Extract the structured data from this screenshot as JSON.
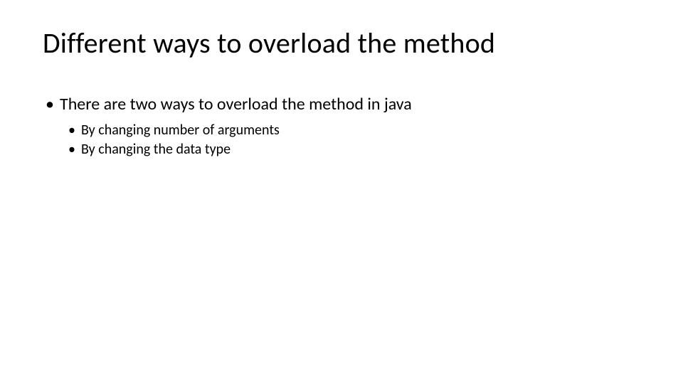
{
  "title": "Different ways to overload the method",
  "bullets": {
    "level1": {
      "item1": "There are two ways to overload the method in java"
    },
    "level2": {
      "item1": "By changing number of arguments",
      "item2": "By changing the data type"
    }
  }
}
